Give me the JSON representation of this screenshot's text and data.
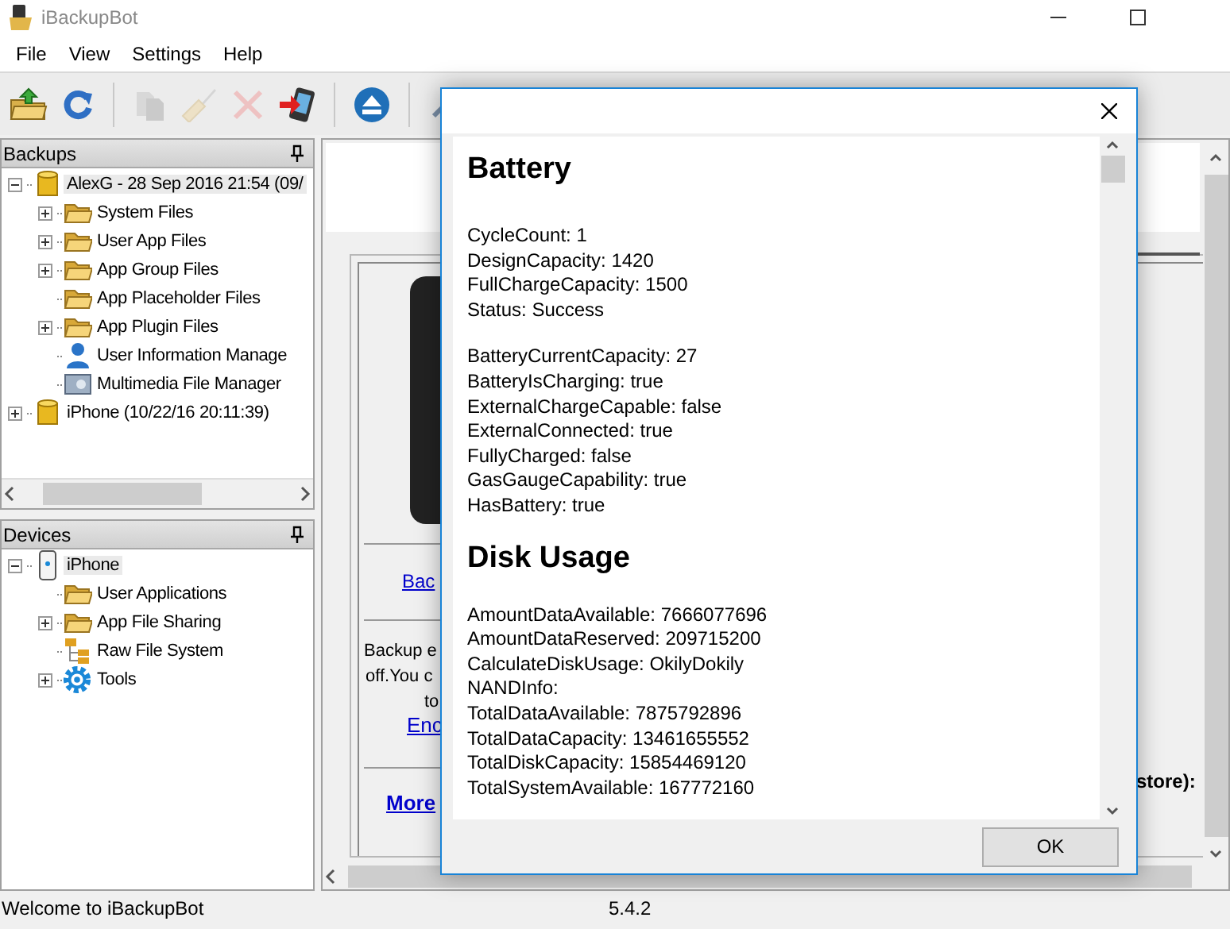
{
  "window": {
    "title": "iBackupBot"
  },
  "menu": [
    "File",
    "View",
    "Settings",
    "Help"
  ],
  "toolbar": [
    {
      "kind": "open",
      "disabled": false
    },
    {
      "kind": "refresh",
      "disabled": false
    },
    {
      "kind": "separator"
    },
    {
      "kind": "copy",
      "disabled": true
    },
    {
      "kind": "clean",
      "disabled": true
    },
    {
      "kind": "delete",
      "disabled": true
    },
    {
      "kind": "transfer",
      "disabled": false
    },
    {
      "kind": "separator"
    },
    {
      "kind": "eject",
      "disabled": false
    },
    {
      "kind": "separator"
    },
    {
      "kind": "tools",
      "disabled": false
    }
  ],
  "backups": {
    "title": "Backups",
    "tree": [
      {
        "label": "AlexG - 28 Sep 2016 21:54 (09/",
        "kind": "database",
        "expanded": true,
        "selected": true,
        "children": [
          {
            "label": "System Files",
            "kind": "folder",
            "expanded": false,
            "selected": false
          },
          {
            "label": "User App Files",
            "kind": "folder",
            "expanded": false,
            "selected": false
          },
          {
            "label": "App Group Files",
            "kind": "folder",
            "expanded": false,
            "selected": false
          },
          {
            "label": "App Placeholder Files",
            "kind": "folder",
            "selected": false
          },
          {
            "label": "App Plugin Files",
            "kind": "folder",
            "expanded": false,
            "selected": false
          },
          {
            "label": "User Information Manage",
            "kind": "user",
            "selected": false
          },
          {
            "label": "Multimedia File Manager",
            "kind": "media",
            "selected": false
          }
        ]
      },
      {
        "label": "iPhone (10/22/16 20:11:39)",
        "kind": "database",
        "expanded": false,
        "selected": false
      }
    ]
  },
  "devices": {
    "title": "Devices",
    "tree": [
      {
        "label": "iPhone",
        "kind": "phone",
        "expanded": true,
        "selected": true,
        "children": [
          {
            "label": "User Applications",
            "kind": "folder",
            "selected": false
          },
          {
            "label": "App File Sharing",
            "kind": "folder",
            "expanded": false,
            "selected": false
          },
          {
            "label": "Raw File System",
            "kind": "filesystem",
            "selected": false
          },
          {
            "label": "Tools",
            "kind": "gear",
            "expanded": false,
            "selected": false
          }
        ]
      }
    ]
  },
  "main_view": {
    "backup_link": "Bac",
    "note_lines": [
      "Backup e",
      "off.You c",
      "to"
    ],
    "note_link": "Enc",
    "more_link": "More",
    "side_label": "store):"
  },
  "dialog": {
    "sections": [
      {
        "heading": "Battery",
        "groups": [
          [
            "CycleCount: 1",
            "DesignCapacity: 1420",
            "FullChargeCapacity: 1500",
            "Status: Success"
          ],
          [
            "BatteryCurrentCapacity: 27",
            "BatteryIsCharging: true",
            "ExternalChargeCapable: false",
            "ExternalConnected: true",
            "FullyCharged: false",
            "GasGaugeCapability: true",
            "HasBattery: true"
          ]
        ]
      },
      {
        "heading": "Disk Usage",
        "groups": [
          [
            "AmountDataAvailable: 7666077696",
            "AmountDataReserved: 209715200",
            "CalculateDiskUsage: OkilyDokily",
            "NANDInfo:",
            "TotalDataAvailable: 7875792896",
            "TotalDataCapacity: 13461655552",
            "TotalDiskCapacity: 15854469120",
            "TotalSystemAvailable: 167772160"
          ]
        ]
      }
    ],
    "ok_button": "OK"
  },
  "status_bar": {
    "message": "Welcome to iBackupBot",
    "version": "5.4.2"
  }
}
